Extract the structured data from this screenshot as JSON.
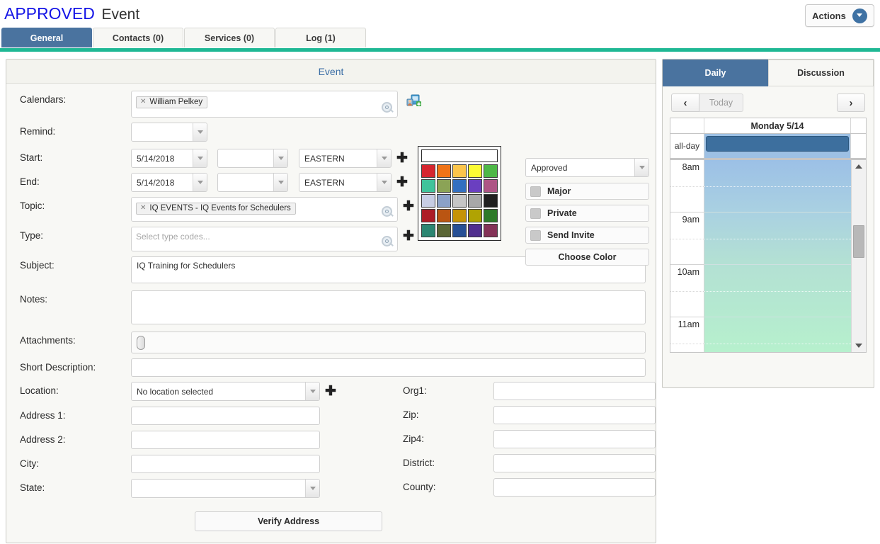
{
  "header": {
    "status": "APPROVED",
    "entity": "Event",
    "actions_label": "Actions",
    "actions_icon": "chevron-down-circle-icon"
  },
  "tabs": [
    {
      "label": "General",
      "active": true
    },
    {
      "label": "Contacts (0)",
      "active": false
    },
    {
      "label": "Services (0)",
      "active": false
    },
    {
      "label": "Log (1)",
      "active": false
    }
  ],
  "main": {
    "panel_title": "Event",
    "labels": {
      "calendars": "Calendars:",
      "remind": "Remind:",
      "start": "Start:",
      "end": "End:",
      "topic": "Topic:",
      "type": "Type:",
      "subject": "Subject:",
      "notes": "Notes:",
      "attachments": "Attachments:",
      "short_description": "Short Description:",
      "location": "Location:",
      "address1": "Address 1:",
      "address2": "Address 2:",
      "city": "City:",
      "state": "State:",
      "org1": "Org1:",
      "zip": "Zip:",
      "zip4": "Zip4:",
      "district": "District:",
      "county": "County:"
    },
    "calendars": {
      "token": "William Pelkey",
      "remove_icon": "remove-token-icon",
      "search_icon": "search-icon",
      "add_icon": "add-calendar-person-icon"
    },
    "remind": {
      "value": ""
    },
    "start": {
      "date": "5/14/2018",
      "time": "",
      "timezone": "EASTERN",
      "add_icon": "plus-icon"
    },
    "end": {
      "date": "5/14/2018",
      "time": "",
      "timezone": "EASTERN",
      "add_icon": "plus-icon"
    },
    "topic": {
      "token": "IQ EVENTS - IQ Events for Schedulers",
      "search_icon": "search-icon",
      "add_icon": "plus-icon"
    },
    "type": {
      "value": "",
      "placeholder": "Select type codes...",
      "search_icon": "search-icon",
      "add_icon": "plus-icon"
    },
    "subject": {
      "value": "IQ Training for Schedulers"
    },
    "notes": {
      "value": ""
    },
    "attachments": {
      "icon": "paperclip-icon",
      "value": ""
    },
    "short_description": {
      "value": ""
    },
    "location": {
      "value": "No location selected",
      "add_icon": "plus-icon"
    },
    "address1": {
      "value": ""
    },
    "address2": {
      "value": ""
    },
    "city": {
      "value": ""
    },
    "state": {
      "value": ""
    },
    "org1": {
      "value": ""
    },
    "zip": {
      "value": ""
    },
    "zip4": {
      "value": ""
    },
    "district": {
      "value": ""
    },
    "county": {
      "value": ""
    },
    "verify_address_label": "Verify Address"
  },
  "status_panel": {
    "approval": {
      "value": "Approved"
    },
    "major": {
      "label": "Major",
      "checked": false
    },
    "private": {
      "label": "Private",
      "checked": false
    },
    "send_invite": {
      "label": "Send Invite",
      "checked": false
    },
    "choose_color_label": "Choose Color"
  },
  "color_palette": {
    "selected": "#ffffff",
    "swatches": [
      "#d5252f",
      "#ef7317",
      "#fcc54b",
      "#fbfb33",
      "#4eb847",
      "#40c39b",
      "#8ba356",
      "#336fc0",
      "#6a3fc0",
      "#ae5585",
      "#c7cde4",
      "#8ba1c8",
      "#c6c6c6",
      "#a8a8a8",
      "#202020",
      "#ad1c26",
      "#ba5512",
      "#c59307",
      "#b0a303",
      "#2f7a2a",
      "#2c8672",
      "#5b6636",
      "#274f95",
      "#512f8f",
      "#843258"
    ]
  },
  "side_panel": {
    "tabs": [
      {
        "label": "Daily",
        "active": true
      },
      {
        "label": "Discussion",
        "active": false
      }
    ],
    "nav": {
      "prev_icon": "chevron-left-icon",
      "prev_label": "‹",
      "today_label": "Today",
      "next_icon": "chevron-right-icon",
      "next_label": "›"
    },
    "day_header": "Monday 5/14",
    "all_day_label": "all-day",
    "hours": [
      "8am",
      "",
      "9am",
      "",
      "10am",
      "",
      "11am",
      ""
    ],
    "hour_labels": [
      "8am",
      "9am",
      "10am",
      "11am"
    ]
  }
}
